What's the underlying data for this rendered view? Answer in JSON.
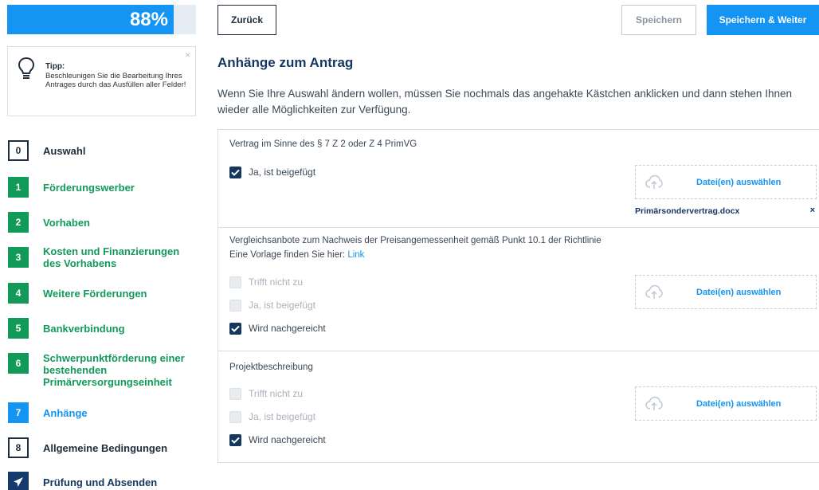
{
  "progress": {
    "percent_text": "88%",
    "value": 0.88
  },
  "tip": {
    "title": "Tipp:",
    "text": "Beschleunigen Sie die Bearbeitung Ihres Antrages durch das Ausfüllen aller Felder!",
    "close": "×"
  },
  "steps": [
    {
      "num": "0",
      "label": "Auswahl",
      "state": "todo"
    },
    {
      "num": "1",
      "label": "Förderungswerber",
      "state": "done"
    },
    {
      "num": "2",
      "label": "Vorhaben",
      "state": "done"
    },
    {
      "num": "3",
      "label": "Kosten und Finanzierungen des Vorhabens",
      "state": "done"
    },
    {
      "num": "4",
      "label": "Weitere Förderungen",
      "state": "done"
    },
    {
      "num": "5",
      "label": "Bankverbindung",
      "state": "done"
    },
    {
      "num": "6",
      "label": "Schwerpunktförderung einer bestehenden Primärversorgungseinheit",
      "state": "done"
    },
    {
      "num": "7",
      "label": "Anhänge",
      "state": "active"
    },
    {
      "num": "8",
      "label": "Allgemeine Bedingungen",
      "state": "todo"
    },
    {
      "num": "",
      "label": "Prüfung und Absenden",
      "state": "final"
    }
  ],
  "toolbar": {
    "back": "Zurück",
    "save": "Speichern",
    "save_next": "Speichern & Weiter"
  },
  "page": {
    "title": "Anhänge zum Antrag",
    "intro": "Wenn Sie Ihre Auswahl ändern wollen, müssen Sie nochmals das angehakte Kästchen anklicken und dann stehen Ihnen wieder alle Möglichkeiten zur Verfügung."
  },
  "sections": [
    {
      "title": "Vertrag im Sinne des § 7 Z 2 oder Z 4 PrimVG",
      "options": [
        {
          "label": "Ja, ist beigefügt",
          "checked": true,
          "disabled": false
        }
      ],
      "upload_label": "Datei(en) auswählen",
      "file": {
        "name": "Primärsondervertrag.docx",
        "remove": "×"
      }
    },
    {
      "title": "Vergleichsanbote zum Nachweis der Preisangemessenheit gemäß Punkt 10.1 der Richtlinie",
      "title_line2": "Eine Vorlage finden Sie hier: ",
      "link": "Link",
      "options": [
        {
          "label": "Trifft nicht zu",
          "checked": false,
          "disabled": true
        },
        {
          "label": "Ja, ist beigefügt",
          "checked": false,
          "disabled": true
        },
        {
          "label": "Wird nachgereicht",
          "checked": true,
          "disabled": false
        }
      ],
      "upload_label": "Datei(en) auswählen"
    },
    {
      "title": "Projektbeschreibung",
      "options": [
        {
          "label": "Trifft nicht zu",
          "checked": false,
          "disabled": true
        },
        {
          "label": "Ja, ist beigefügt",
          "checked": false,
          "disabled": true
        },
        {
          "label": "Wird nachgereicht",
          "checked": true,
          "disabled": false
        }
      ],
      "upload_label": "Datei(en) auswählen"
    }
  ],
  "colors": {
    "accent": "#1494f3",
    "done": "#119a5a",
    "navy": "#14365f"
  }
}
